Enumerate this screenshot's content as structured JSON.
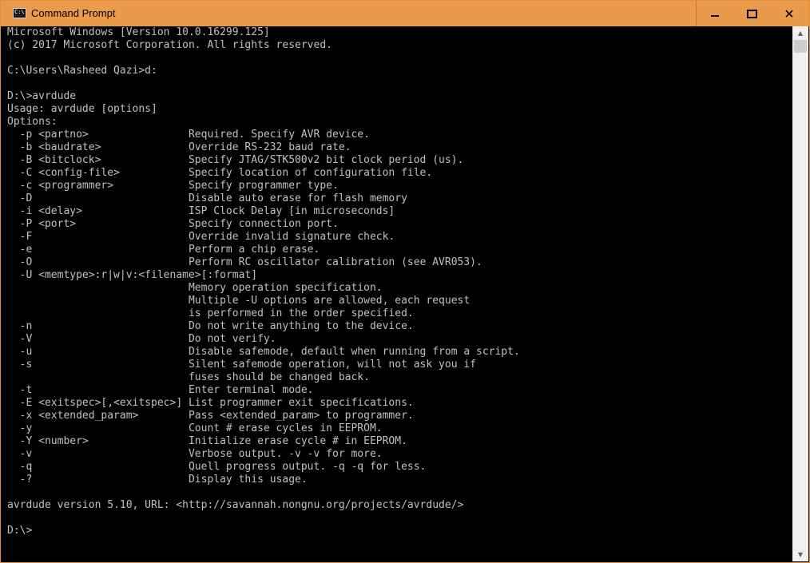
{
  "window": {
    "title": "Command Prompt",
    "icon": "cmd-icon",
    "icon_glyph": "C:\\",
    "accent": "#e99a4a",
    "controls": {
      "minimize": "minimize-icon",
      "maximize": "maximize-icon",
      "close": "close-icon",
      "close_glyph": "✕"
    }
  },
  "console": {
    "background": "#000000",
    "foreground": "#c0c0c0",
    "lines": [
      "Microsoft Windows [Version 10.0.16299.125]",
      "(c) 2017 Microsoft Corporation. All rights reserved.",
      "",
      "C:\\Users\\Rasheed Qazi>d:",
      "",
      "D:\\>avrdude",
      "Usage: avrdude [options]",
      "Options:",
      "  -p <partno>                Required. Specify AVR device.",
      "  -b <baudrate>              Override RS-232 baud rate.",
      "  -B <bitclock>              Specify JTAG/STK500v2 bit clock period (us).",
      "  -C <config-file>           Specify location of configuration file.",
      "  -c <programmer>            Specify programmer type.",
      "  -D                         Disable auto erase for flash memory",
      "  -i <delay>                 ISP Clock Delay [in microseconds]",
      "  -P <port>                  Specify connection port.",
      "  -F                         Override invalid signature check.",
      "  -e                         Perform a chip erase.",
      "  -O                         Perform RC oscillator calibration (see AVR053).",
      "  -U <memtype>:r|w|v:<filename>[:format]",
      "                             Memory operation specification.",
      "                             Multiple -U options are allowed, each request",
      "                             is performed in the order specified.",
      "  -n                         Do not write anything to the device.",
      "  -V                         Do not verify.",
      "  -u                         Disable safemode, default when running from a script.",
      "  -s                         Silent safemode operation, will not ask you if",
      "                             fuses should be changed back.",
      "  -t                         Enter terminal mode.",
      "  -E <exitspec>[,<exitspec>] List programmer exit specifications.",
      "  -x <extended_param>        Pass <extended_param> to programmer.",
      "  -y                         Count # erase cycles in EEPROM.",
      "  -Y <number>                Initialize erase cycle # in EEPROM.",
      "  -v                         Verbose output. -v -v for more.",
      "  -q                         Quell progress output. -q -q for less.",
      "  -?                         Display this usage.",
      "",
      "avrdude version 5.10, URL: <http://savannah.nongnu.org/projects/avrdude/>",
      "",
      "D:\\>"
    ]
  },
  "scrollbar": {
    "up": "scroll-up-icon",
    "down": "scroll-down-icon",
    "up_glyph": "▲",
    "down_glyph": "▼"
  }
}
